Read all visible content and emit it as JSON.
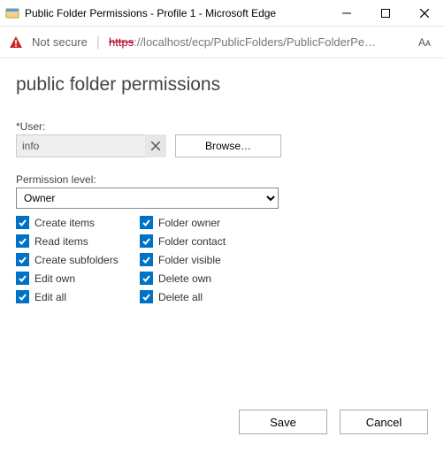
{
  "window": {
    "title": "Public Folder Permissions - Profile 1 - Microsoft Edge"
  },
  "address": {
    "secure_text": "Not secure",
    "scheme": "https",
    "rest": "://localhost/ecp/PublicFolders/PublicFolderPe…",
    "reader_label": "Aᴀ"
  },
  "page": {
    "title": "public folder permissions"
  },
  "user": {
    "label": "*User:",
    "value": "info",
    "browse": "Browse…"
  },
  "permission": {
    "label": "Permission level:",
    "selected": "Owner",
    "options": [
      "Owner"
    ]
  },
  "permissions": [
    {
      "label": "Create items",
      "checked": true
    },
    {
      "label": "Folder owner",
      "checked": true
    },
    {
      "label": "Read items",
      "checked": true
    },
    {
      "label": "Folder contact",
      "checked": true
    },
    {
      "label": "Create subfolders",
      "checked": true
    },
    {
      "label": "Folder visible",
      "checked": true
    },
    {
      "label": "Edit own",
      "checked": true
    },
    {
      "label": "Delete own",
      "checked": true
    },
    {
      "label": "Edit all",
      "checked": true
    },
    {
      "label": "Delete all",
      "checked": true
    }
  ],
  "actions": {
    "save": "Save",
    "cancel": "Cancel"
  }
}
